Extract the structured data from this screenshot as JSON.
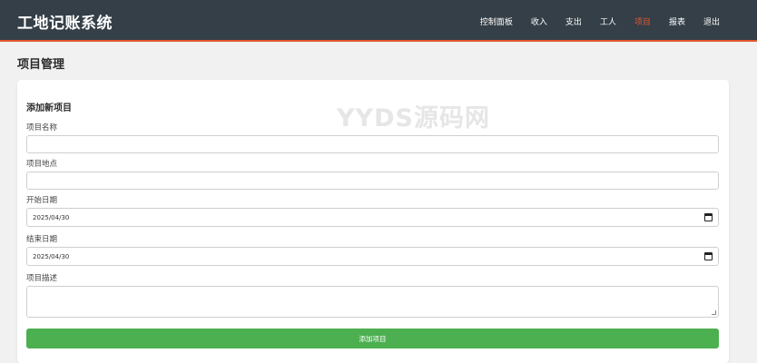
{
  "app": {
    "title": "工地记账系统"
  },
  "nav": {
    "items": [
      {
        "label": "控制面板",
        "active": false
      },
      {
        "label": "收入",
        "active": false
      },
      {
        "label": "支出",
        "active": false
      },
      {
        "label": "工人",
        "active": false
      },
      {
        "label": "项目",
        "active": true
      },
      {
        "label": "报表",
        "active": false
      },
      {
        "label": "退出",
        "active": false
      }
    ]
  },
  "page": {
    "title": "项目管理"
  },
  "form": {
    "title": "添加新项目",
    "name_label": "项目名称",
    "name_value": "",
    "location_label": "项目地点",
    "location_value": "",
    "start_label": "开始日期",
    "start_value": "2025/04/30",
    "end_label": "结束日期",
    "end_value": "2025/04/30",
    "desc_label": "项目描述",
    "desc_value": "",
    "submit_label": "添加项目"
  },
  "watermark": "YYDS源码网",
  "colors": {
    "header_bg": "#343f47",
    "accent": "#e9552c",
    "button": "#4caf50"
  }
}
